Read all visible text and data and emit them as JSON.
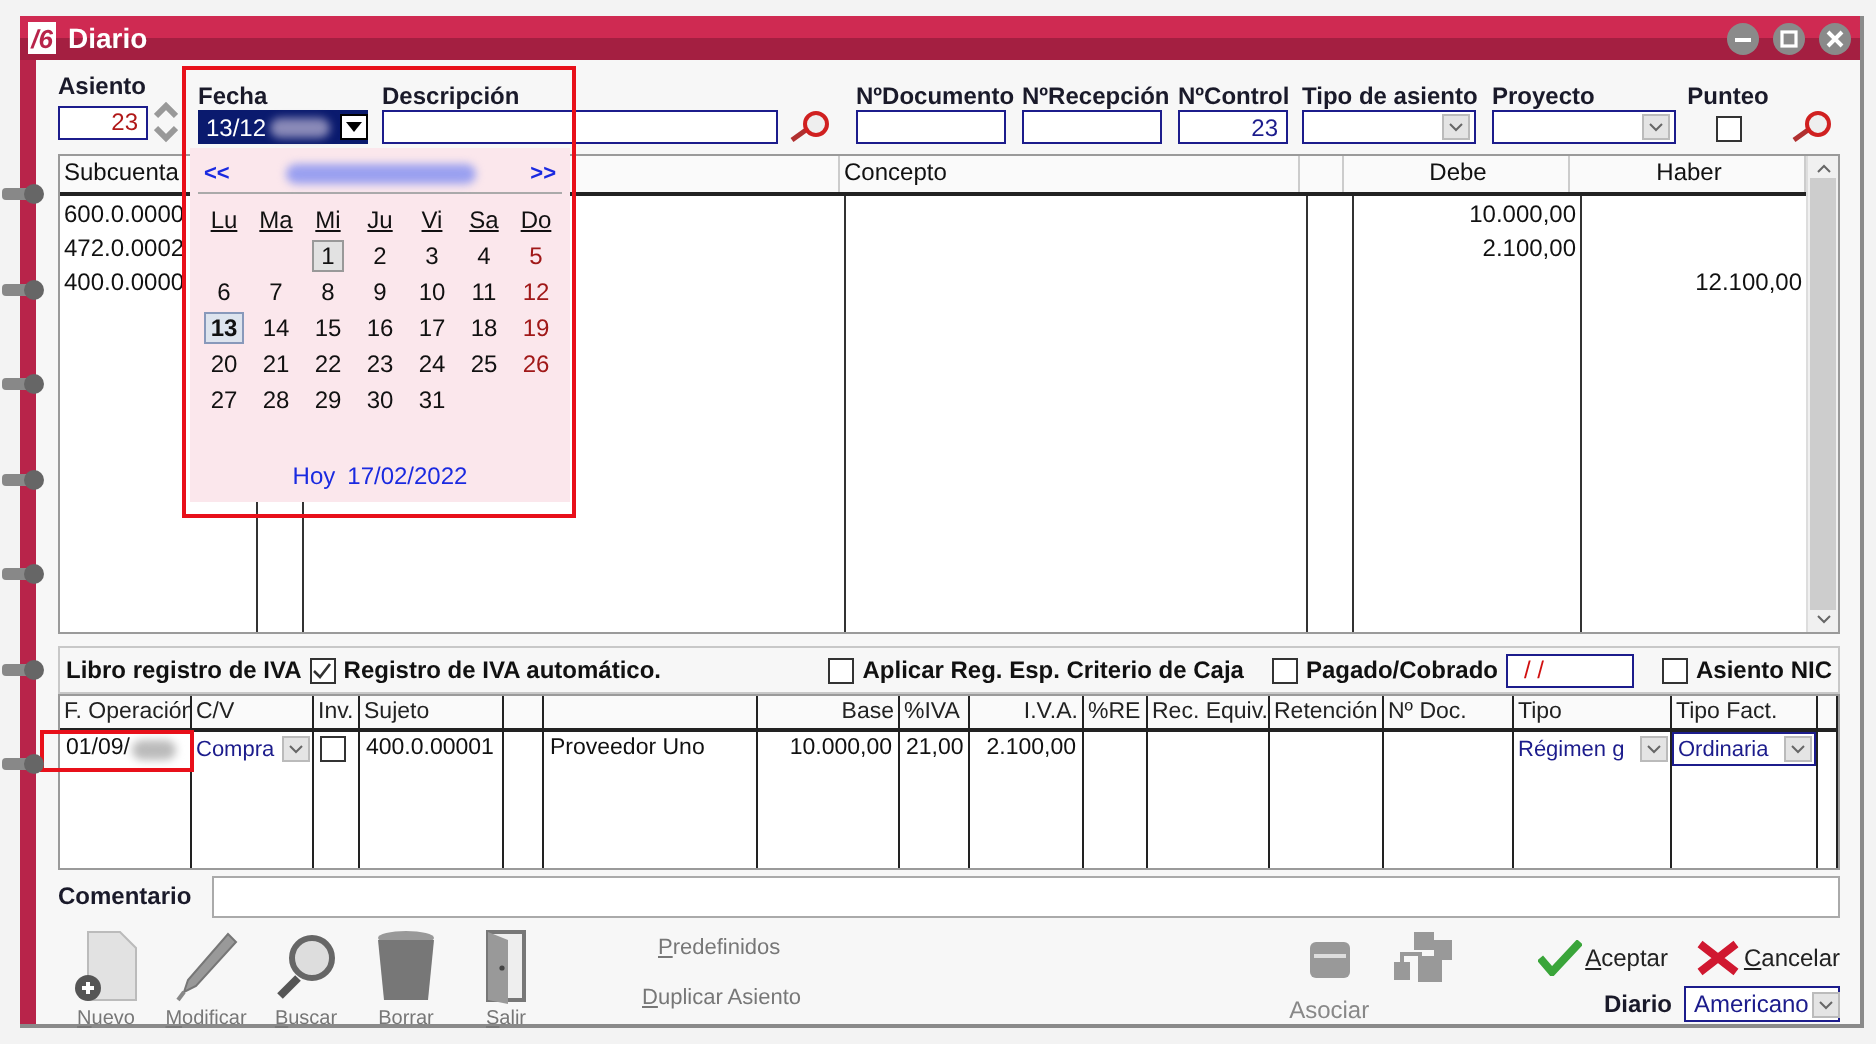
{
  "window": {
    "logo": "/6",
    "title": "Diario"
  },
  "header": {
    "fields": [
      {
        "kind": "spin-number",
        "label": "Asiento",
        "value": "23"
      },
      {
        "kind": "date",
        "label": "Fecha",
        "value": "13/12",
        "annotated": true
      },
      {
        "kind": "text",
        "label": "Descripción"
      },
      {
        "kind": "search-button"
      },
      {
        "kind": "text",
        "label": "NºDocumento"
      },
      {
        "kind": "text",
        "label": "NºRecepción"
      },
      {
        "kind": "number",
        "label": "NºControl",
        "value": "23"
      },
      {
        "kind": "combo",
        "label": "Tipo de asiento"
      },
      {
        "kind": "combo",
        "label": "Proyecto"
      },
      {
        "kind": "checkbox",
        "label": "Punteo",
        "checked": false
      },
      {
        "kind": "search-button"
      }
    ]
  },
  "grid": {
    "columns": [
      {
        "label": "Subcuenta"
      },
      {},
      {},
      {
        "label": "Concepto"
      },
      {},
      {
        "label": "Debe"
      },
      {
        "label": "Haber"
      }
    ],
    "rows": [
      {
        "account": "600.0.0000",
        "debit": "10.000,00"
      },
      {
        "account": "472.0.0002",
        "debit": "2.100,00"
      },
      {
        "account": "400.0.0000",
        "credit": "12.100,00"
      }
    ]
  },
  "calendar": {
    "prev": "<<",
    "next": ">>",
    "weekdays": [
      "Lu",
      "Ma",
      "Mi",
      "Ju",
      "Vi",
      "Sa",
      "Do"
    ],
    "weeks": [
      [
        {
          "kind": "blank"
        },
        {
          "kind": "blank"
        },
        {
          "kind": "day",
          "day": "1",
          "selected": false,
          "focused": true
        },
        {
          "kind": "day",
          "day": "2",
          "selected": false,
          "focused": false
        },
        {
          "kind": "day",
          "day": "3",
          "selected": false,
          "focused": false
        },
        {
          "kind": "day",
          "day": "4",
          "selected": false,
          "focused": false
        },
        {
          "kind": "day",
          "day": "5",
          "selected": false,
          "focused": false
        }
      ],
      [
        {
          "kind": "day",
          "day": "6",
          "selected": false,
          "focused": false
        },
        {
          "kind": "day",
          "day": "7",
          "selected": false,
          "focused": false
        },
        {
          "kind": "day",
          "day": "8",
          "selected": false,
          "focused": false
        },
        {
          "kind": "day",
          "day": "9",
          "selected": false,
          "focused": false
        },
        {
          "kind": "day",
          "day": "10",
          "selected": false,
          "focused": false
        },
        {
          "kind": "day",
          "day": "11",
          "selected": false,
          "focused": false
        },
        {
          "kind": "day",
          "day": "12",
          "selected": false,
          "focused": false
        }
      ],
      [
        {
          "kind": "day",
          "day": "13",
          "selected": true,
          "focused": false
        },
        {
          "kind": "day",
          "day": "14",
          "selected": false,
          "focused": false
        },
        {
          "kind": "day",
          "day": "15",
          "selected": false,
          "focused": false
        },
        {
          "kind": "day",
          "day": "16",
          "selected": false,
          "focused": false
        },
        {
          "kind": "day",
          "day": "17",
          "selected": false,
          "focused": false
        },
        {
          "kind": "day",
          "day": "18",
          "selected": false,
          "focused": false
        },
        {
          "kind": "day",
          "day": "19",
          "selected": false,
          "focused": false
        }
      ],
      [
        {
          "kind": "day",
          "day": "20",
          "selected": false,
          "focused": false
        },
        {
          "kind": "day",
          "day": "21",
          "selected": false,
          "focused": false
        },
        {
          "kind": "day",
          "day": "22",
          "selected": false,
          "focused": false
        },
        {
          "kind": "day",
          "day": "23",
          "selected": false,
          "focused": false
        },
        {
          "kind": "day",
          "day": "24",
          "selected": false,
          "focused": false
        },
        {
          "kind": "day",
          "day": "25",
          "selected": false,
          "focused": false
        },
        {
          "kind": "day",
          "day": "26",
          "selected": false,
          "focused": false
        }
      ],
      [
        {
          "kind": "day",
          "day": "27",
          "selected": false,
          "focused": false
        },
        {
          "kind": "day",
          "day": "28",
          "selected": false,
          "focused": false
        },
        {
          "kind": "day",
          "day": "29",
          "selected": false,
          "focused": false
        },
        {
          "kind": "day",
          "day": "30",
          "selected": false,
          "focused": false
        },
        {
          "kind": "day",
          "day": "31",
          "selected": false,
          "focused": false
        }
      ]
    ],
    "today_label": "Hoy",
    "today_date": "17/02/2022"
  },
  "iva_bar": {
    "title": "Libro registro de IVA",
    "options": [
      {
        "kind": "checkbox",
        "label": "Registro de IVA automático.",
        "checked": true
      },
      {
        "kind": "checkbox",
        "label": "Aplicar Reg. Esp. Criterio de Caja",
        "checked": false
      },
      {
        "kind": "checkbox",
        "label": "Pagado/Cobrado",
        "checked": false
      },
      {
        "kind": "date",
        "value": "/ /"
      },
      {
        "kind": "checkbox",
        "label": "Asiento NIC",
        "checked": false
      }
    ]
  },
  "iva_table": {
    "columns": [
      {
        "label": "F. Operación"
      },
      {
        "label": "C/V"
      },
      {
        "label": "Inv."
      },
      {
        "label": "Sujeto"
      },
      {},
      {},
      {
        "label": "Base"
      },
      {
        "label": "%IVA"
      },
      {
        "label": "I.V.A."
      },
      {
        "label": "%RE"
      },
      {
        "label": "Rec. Equiv."
      },
      {
        "label": "Retención"
      },
      {
        "label": "Nº Doc."
      },
      {
        "label": "Tipo"
      },
      {
        "label": "Tipo Fact."
      },
      {}
    ],
    "row": [
      {
        "kind": "date",
        "text": "01/09/",
        "annotated": true
      },
      {
        "kind": "combo",
        "text": "Compra",
        "focused": false
      },
      {
        "kind": "checkbox",
        "checked": false
      },
      {
        "kind": "text",
        "text": "400.0.00001"
      },
      {
        "kind": "empty"
      },
      {
        "kind": "text",
        "text": "Proveedor Uno"
      },
      {
        "kind": "number",
        "text": "10.000,00"
      },
      {
        "kind": "number",
        "text": "21,00"
      },
      {
        "kind": "number",
        "text": "2.100,00"
      },
      {
        "kind": "empty"
      },
      {
        "kind": "empty"
      },
      {
        "kind": "empty"
      },
      {
        "kind": "empty"
      },
      {
        "kind": "combo",
        "text": "Régimen g",
        "focused": false
      },
      {
        "kind": "combo",
        "text": "Ordinaria",
        "focused": true
      },
      {
        "kind": "empty"
      }
    ]
  },
  "comment": {
    "label": "Comentario"
  },
  "toolbar": {
    "actions": [
      {
        "kind": "new",
        "label": "Nuevo",
        "mnemonic": true
      },
      {
        "kind": "edit",
        "label": "Modificar",
        "mnemonic": true
      },
      {
        "kind": "search",
        "label": "Buscar",
        "mnemonic": true
      },
      {
        "kind": "delete",
        "label": "Borrar",
        "mnemonic": false
      },
      {
        "kind": "exit",
        "label": "Salir",
        "mnemonic": true
      }
    ],
    "links": [
      {
        "label": "Predefinidos",
        "mnemonic": true
      },
      {
        "label": "Duplicar Asiento",
        "mnemonic": true
      }
    ],
    "associate": {
      "label": "Asociar"
    },
    "accept": {
      "label": "Aceptar",
      "mnemonic": true
    },
    "cancel": {
      "label": "Cancelar",
      "mnemonic": true
    },
    "journal": {
      "label": "Diario",
      "value": "Americano"
    }
  }
}
